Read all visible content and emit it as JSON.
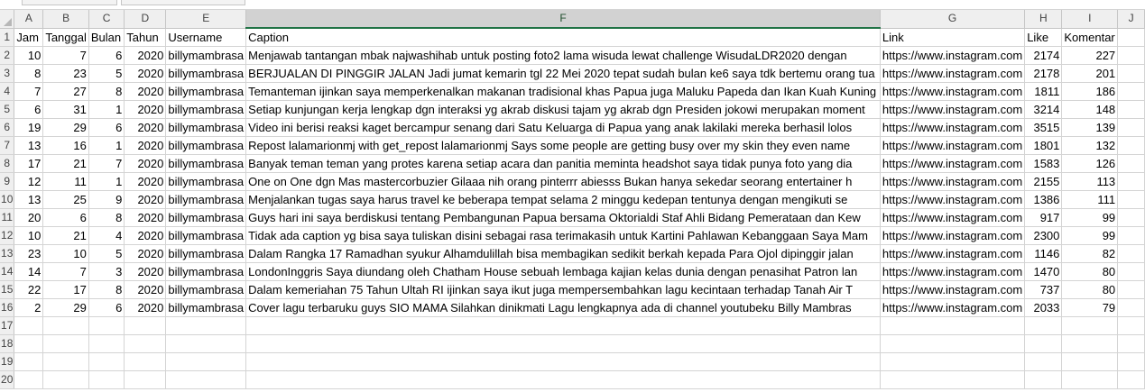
{
  "columns": [
    "A",
    "B",
    "C",
    "D",
    "E",
    "F",
    "G",
    "H",
    "I",
    "J"
  ],
  "active_column": "F",
  "header_row": [
    "Jam",
    "Tanggal",
    "Bulan",
    "Tahun",
    "Username",
    "Caption",
    "Link",
    "Like",
    "Komentar",
    ""
  ],
  "data_rows": [
    [
      "10",
      "7",
      "6",
      "2020",
      "billymambrasa",
      "Menjawab tantangan mbak najwashihab untuk posting foto2 lama wisuda lewat challenge WisudaLDR2020 dengan",
      "https://www.instagram.com",
      "2174",
      "227",
      ""
    ],
    [
      "8",
      "23",
      "5",
      "2020",
      "billymambrasa",
      "BERJUALAN DI PINGGIR JALAN Jadi jumat kemarin tgl 22 Mei 2020 tepat sudah bulan ke6 saya tdk bertemu orang tua",
      "https://www.instagram.com",
      "2178",
      "201",
      ""
    ],
    [
      "7",
      "27",
      "8",
      "2020",
      "billymambrasa",
      "Temanteman ijinkan saya memperkenalkan makanan tradisional khas Papua juga Maluku Papeda dan Ikan Kuah Kuning",
      "https://www.instagram.com",
      "1811",
      "186",
      ""
    ],
    [
      "6",
      "31",
      "1",
      "2020",
      "billymambrasa",
      "Setiap kunjungan kerja lengkap dgn interaksi yg akrab  diskusi tajam yg akrab dgn Presiden jokowi merupakan moment",
      "https://www.instagram.com",
      "3214",
      "148",
      ""
    ],
    [
      "19",
      "29",
      "6",
      "2020",
      "billymambrasa",
      "Video ini berisi reaksi kaget bercampur senang dari Satu Keluarga di Papua yang anak lakilaki mereka berhasil lolos",
      "https://www.instagram.com",
      "3515",
      "139",
      ""
    ],
    [
      "13",
      "16",
      "1",
      "2020",
      "billymambrasa",
      "Repost lalamarionmj with get_repost  lalamarionmj Says some people are getting busy over my skin they even name",
      "https://www.instagram.com",
      "1801",
      "132",
      ""
    ],
    [
      "17",
      "21",
      "7",
      "2020",
      "billymambrasa",
      "Banyak teman teman yang protes karena setiap acara dan panitia meminta headshot saya tidak punya foto yang dia",
      "https://www.instagram.com",
      "1583",
      "126",
      ""
    ],
    [
      "12",
      "11",
      "1",
      "2020",
      "billymambrasa",
      "One on One dgn Mas mastercorbuzier Gilaaa nih orang pinterrr abiesss  Bukan hanya sekedar seorang entertainer  h",
      "https://www.instagram.com",
      "2155",
      "113",
      ""
    ],
    [
      "13",
      "25",
      "9",
      "2020",
      "billymambrasa",
      "Menjalankan tugas saya harus travel ke beberapa tempat selama 2 minggu kedepan tentunya dengan mengikuti se",
      "https://www.instagram.com",
      "1386",
      "111",
      ""
    ],
    [
      "20",
      "6",
      "8",
      "2020",
      "billymambrasa",
      "Guys hari ini saya berdiskusi tentang Pembangunan Papua bersama Oktorialdi Staf Ahli Bidang Pemerataan dan Kew",
      "https://www.instagram.com",
      "917",
      "99",
      ""
    ],
    [
      "10",
      "21",
      "4",
      "2020",
      "billymambrasa",
      "Tidak ada caption yg bisa saya tuliskan disini sebagai rasa terimakasih untuk Kartini Pahlawan Kebanggaan Saya Mam",
      "https://www.instagram.com",
      "2300",
      "99",
      ""
    ],
    [
      "23",
      "10",
      "5",
      "2020",
      "billymambrasa",
      "Dalam Rangka 17 Ramadhan syukur Alhamdulillah bisa membagikan sedikit berkah kepada Para Ojol dipinggir jalan",
      "https://www.instagram.com",
      "1146",
      "82",
      ""
    ],
    [
      "14",
      "7",
      "3",
      "2020",
      "billymambrasa",
      "LondonInggris Saya diundang oleh Chatham House sebuah lembaga kajian kelas dunia dengan penasihat Patron lan",
      "https://www.instagram.com",
      "1470",
      "80",
      ""
    ],
    [
      "22",
      "17",
      "8",
      "2020",
      "billymambrasa",
      "Dalam kemeriahan 75 Tahun Ultah RI ijinkan saya ikut juga mempersembahkan lagu kecintaan terhadap Tanah Air T",
      "https://www.instagram.com",
      "737",
      "80",
      ""
    ],
    [
      "2",
      "29",
      "6",
      "2020",
      "billymambrasa",
      "Cover lagu terbaruku guys  SIO MAMA Silahkan dinikmati Lagu lengkapnya ada di channel youtubeku Billy Mambras",
      "https://www.instagram.com",
      "2033",
      "79",
      ""
    ]
  ],
  "empty_rows": 4
}
